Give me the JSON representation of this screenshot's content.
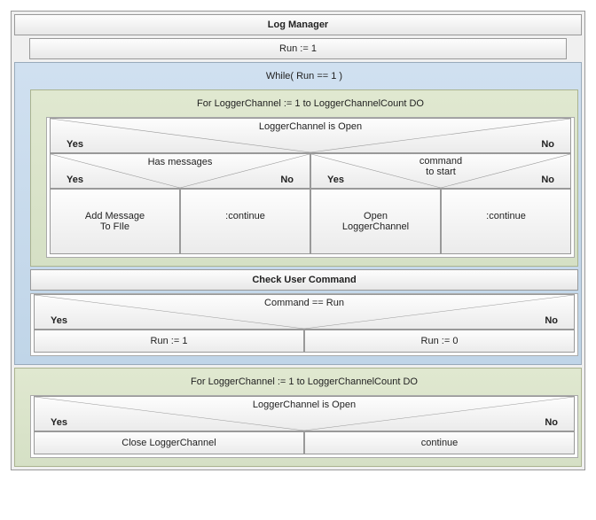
{
  "title": "Log Manager",
  "run_init": "Run := 1",
  "while_cond": "While( Run == 1 )",
  "for_loop1": "For LoggerChannel := 1 to LoggerChannelCount DO",
  "dec_open": {
    "label": "LoggerChannel is Open",
    "yes": "Yes",
    "no": "No"
  },
  "dec_has_msg": {
    "label": "Has messages",
    "yes": "Yes",
    "no": "No"
  },
  "dec_cmd_start": {
    "label": "command\nto start",
    "yes": "Yes",
    "no": "No"
  },
  "act_add": "Add Message\nTo FIle",
  "act_continue": ":continue",
  "act_open": "Open\nLoggerChannel",
  "check_user": "Check User Command",
  "dec_cmd_run": {
    "label": "Command == Run",
    "yes": "Yes",
    "no": "No"
  },
  "run_set1": "Run := 1",
  "run_set0": "Run := 0",
  "for_loop2": "For LoggerChannel := 1 to LoggerChannelCount DO",
  "dec_open2": {
    "label": "LoggerChannel is Open",
    "yes": "Yes",
    "no": "No"
  },
  "act_close": "Close LoggerChannel",
  "act_continue2": "continue"
}
